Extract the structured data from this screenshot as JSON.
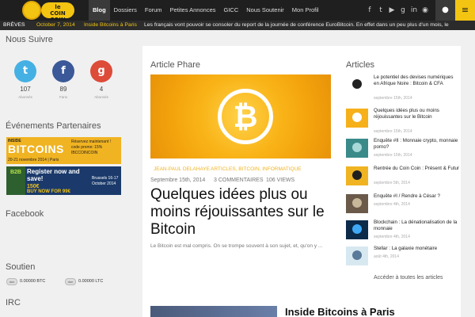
{
  "logo": {
    "line1": "le",
    "line2": "COIN",
    "line3": "COIN"
  },
  "nav": {
    "items": [
      "Blog",
      "Dossiers",
      "Forum",
      "Petites Annonces",
      "GICC",
      "Nous Soutenir",
      "Mon Profil"
    ],
    "active": "Blog"
  },
  "social_icons": [
    "facebook-icon",
    "twitter-icon",
    "youtube-icon",
    "google-plus-icon",
    "linkedin-icon",
    "rss-icon"
  ],
  "ticker": {
    "label": "BRÈVES",
    "date": "October 7, 2014",
    "headline": "Inside Bitcoins à Paris",
    "text": "Les français vont pouvoir se consoler du report de la journée de conférence EuroBitcoin. En effet dans un peu plus d'un mois, le"
  },
  "sidebar": {
    "follow_title": "Nous Suivre",
    "networks": [
      {
        "name": "twitter",
        "icon": "twitter-icon",
        "glyph": "t",
        "count": "107",
        "label": "Abonnés"
      },
      {
        "name": "facebook",
        "icon": "facebook-icon",
        "glyph": "f",
        "count": "89",
        "label": "Fans"
      },
      {
        "name": "google",
        "icon": "google-plus-icon",
        "glyph": "g",
        "count": "4",
        "label": "Abonnés"
      }
    ],
    "events_title": "Événements Partenaires",
    "banner1": {
      "inside": "INSIDE",
      "bitcoins": "BITCOINS",
      "when": "20-21 novembre 2014 | Paris",
      "promo": "Réservez maintenant !",
      "code": "code promo: 15% IBCCOINCOIN"
    },
    "banner2": {
      "b2b": "B2B",
      "register": "Register now and save!",
      "price": "150€",
      "buy": "BUY NOW FOR 99€",
      "city": "Brussels 16-17 October 2014"
    },
    "facebook_title": "Facebook",
    "soutien_title": "Soutien",
    "donations": [
      {
        "label": "0.00000 BTC",
        "button": "don"
      },
      {
        "label": "0.00000 LTC",
        "button": "don"
      }
    ],
    "irc_title": "IRC"
  },
  "featured": {
    "section_title": "Article Phare",
    "author": "JEAN-PAUL DELAHAYE",
    "categories": "ARTICLES, BITCOIN, INFORMATIQUE",
    "date": "Septembre 15th, 2014",
    "comments": "3 COMMENTAIRES",
    "views": "106 VIEWS",
    "title": "Quelques idées plus ou moins réjouissantes sur le Bitcoin",
    "excerpt": "Le Bitcoin est mal compris. On se trompe souvent à son sujet, et, qu'on y ..."
  },
  "second_article": {
    "title": "Inside Bitcoins à Paris"
  },
  "articles": {
    "section_title": "Articles",
    "items": [
      {
        "title": "Le potentiel des devises numériques en Afrique Noire : Bitcoin & CFA",
        "date": "septembre 15th, 2014",
        "thumb": "#ffffff",
        "accent": "#222222"
      },
      {
        "title": "Quelques idées plus ou moins réjouissantes sur le Bitcoin",
        "date": "septembre 15th, 2014",
        "thumb": "#f6b01a",
        "accent": "#ffffff"
      },
      {
        "title": "Enquête #II : Monnaie crypto, monnaie porno?",
        "date": "septembre 15th, 2014",
        "thumb": "#3a8a8a",
        "accent": "#a8d8d8"
      },
      {
        "title": "Rentrée du Coin Coin : Présent & Futur",
        "date": "septembre 5th, 2014",
        "thumb": "#f0b322",
        "accent": "#1f1f1f"
      },
      {
        "title": "Enquête #I / Rendre à César ?",
        "date": "septembre 4th, 2014",
        "thumb": "#6b5a4a",
        "accent": "#c9b79a"
      },
      {
        "title": "Blockchain : La dénationalisation de la monnaie",
        "date": "septembre 4th, 2014",
        "thumb": "#0c2a4a",
        "accent": "#3fa9f5"
      },
      {
        "title": "Stellar : La galaxie monétaire",
        "date": "août 4th, 2014",
        "thumb": "#d8e8f0",
        "accent": "#5a7a9a"
      }
    ],
    "all_link": "Accéder à toutes les articles"
  }
}
